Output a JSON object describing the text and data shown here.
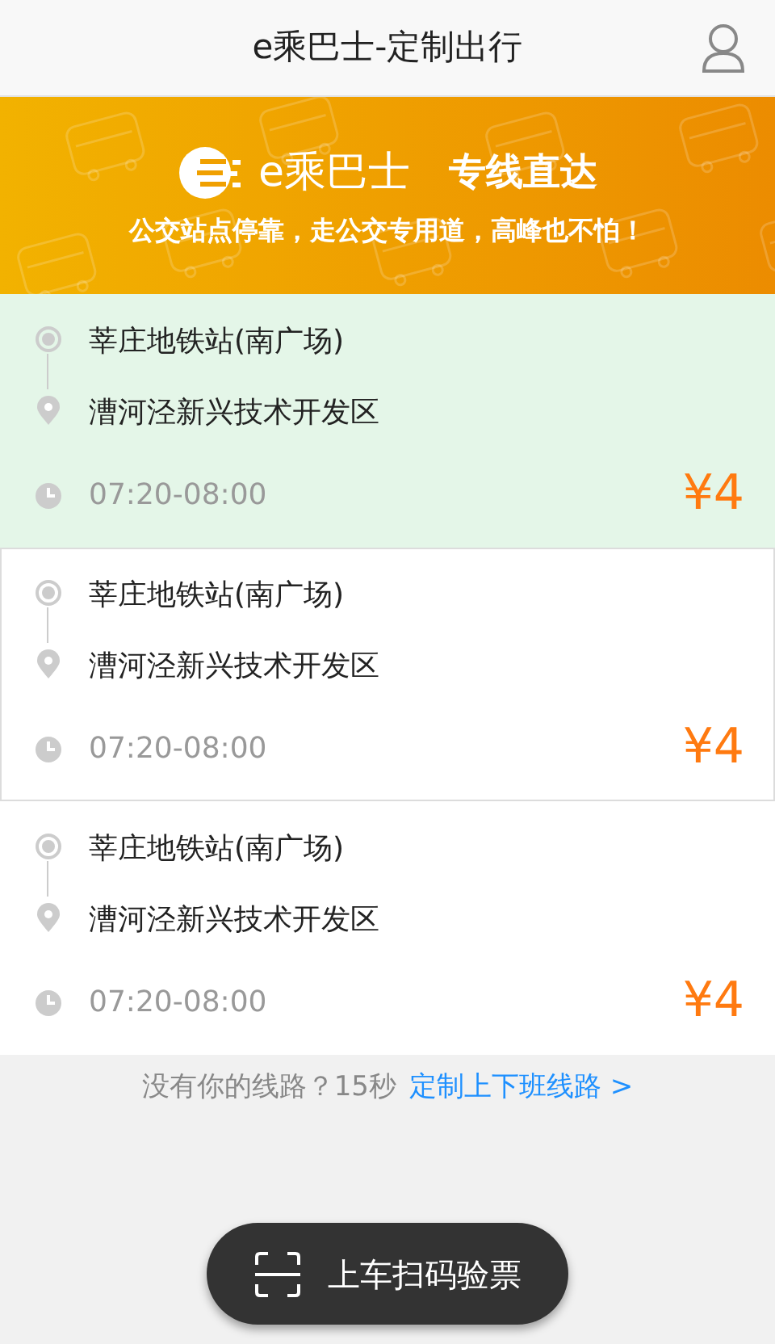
{
  "header": {
    "title": "e乘巴士-定制出行"
  },
  "banner": {
    "brand": "e乘巴士",
    "slogan": "专线直达",
    "tagline": "公交站点停靠，走公交专用道，高峰也不怕！"
  },
  "routes": [
    {
      "from": "莘庄地铁站(南广场)",
      "to": "漕河泾新兴技术开发区",
      "time": "07:20-08:00",
      "price": "¥4",
      "selected": true,
      "outlined": false
    },
    {
      "from": "莘庄地铁站(南广场)",
      "to": "漕河泾新兴技术开发区",
      "time": "07:20-08:00",
      "price": "¥4",
      "selected": false,
      "outlined": true
    },
    {
      "from": "莘庄地铁站(南广场)",
      "to": "漕河泾新兴技术开发区",
      "time": "07:20-08:00",
      "price": "¥4",
      "selected": false,
      "outlined": false
    }
  ],
  "footer": {
    "prompt": "没有你的线路？15秒",
    "link": "定制上下班线路 >"
  },
  "scan_button": {
    "label": "上车扫码验票"
  }
}
